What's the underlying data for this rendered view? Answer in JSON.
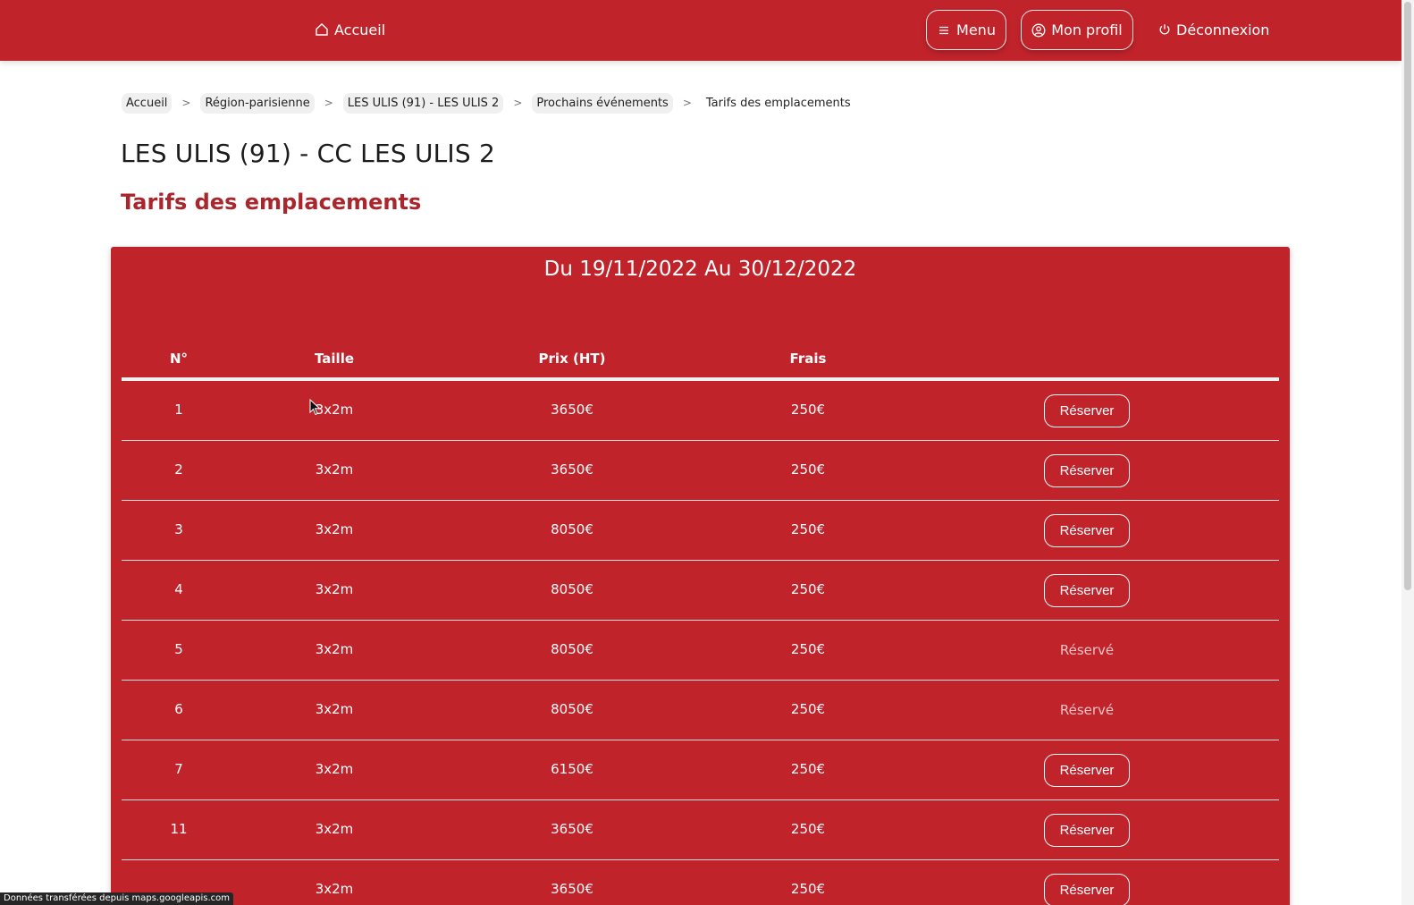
{
  "nav": {
    "home_label": "Accueil",
    "menu_label": "Menu",
    "profile_label": "Mon profil",
    "logout_label": "Déconnexion"
  },
  "breadcrumb": {
    "items": [
      "Accueil",
      "Région-parisienne",
      "LES ULIS (91) - LES ULIS 2",
      "Prochains événements"
    ],
    "current": "Tarifs des emplacements"
  },
  "page": {
    "title": "LES ULIS (91) - CC LES ULIS 2",
    "section_title": "Tarifs des emplacements"
  },
  "panel": {
    "heading": "Du 19/11/2022 Au 30/12/2022",
    "columns": [
      "N°",
      "Taille",
      "Prix (HT)",
      "Frais"
    ],
    "rows": [
      {
        "num": "1",
        "size": "3x2m",
        "price": "3650€",
        "fee": "250€",
        "action": "Réserver",
        "reserved": false
      },
      {
        "num": "2",
        "size": "3x2m",
        "price": "3650€",
        "fee": "250€",
        "action": "Réserver",
        "reserved": false
      },
      {
        "num": "3",
        "size": "3x2m",
        "price": "8050€",
        "fee": "250€",
        "action": "Réserver",
        "reserved": false
      },
      {
        "num": "4",
        "size": "3x2m",
        "price": "8050€",
        "fee": "250€",
        "action": "Réserver",
        "reserved": false
      },
      {
        "num": "5",
        "size": "3x2m",
        "price": "8050€",
        "fee": "250€",
        "action": "Réservé",
        "reserved": true
      },
      {
        "num": "6",
        "size": "3x2m",
        "price": "8050€",
        "fee": "250€",
        "action": "Réservé",
        "reserved": true
      },
      {
        "num": "7",
        "size": "3x2m",
        "price": "6150€",
        "fee": "250€",
        "action": "Réserver",
        "reserved": false
      },
      {
        "num": "11",
        "size": "3x2m",
        "price": "3650€",
        "fee": "250€",
        "action": "Réserver",
        "reserved": false
      },
      {
        "num": "",
        "size": "3x2m",
        "price": "3650€",
        "fee": "250€",
        "action": "Réserver",
        "reserved": false
      }
    ]
  },
  "status_bar": {
    "text": "Données transférées depuis maps.googleapis.com"
  },
  "colors": {
    "brand_red": "#c1232b",
    "section_title": "#a8262c"
  }
}
